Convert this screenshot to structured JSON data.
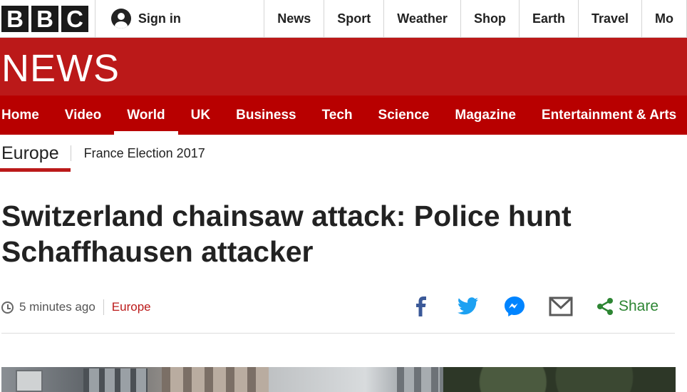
{
  "topbar": {
    "logo_letters": [
      "B",
      "B",
      "C"
    ],
    "signin_label": "Sign in",
    "nav": [
      "News",
      "Sport",
      "Weather",
      "Shop",
      "Earth",
      "Travel",
      "Mo"
    ]
  },
  "news": {
    "wordmark": "NEWS",
    "sections": [
      "Home",
      "Video",
      "World",
      "UK",
      "Business",
      "Tech",
      "Science",
      "Magazine",
      "Entertainment & Arts"
    ],
    "active_section": "World"
  },
  "subnav": {
    "current": "Europe",
    "link": "France Election 2017"
  },
  "article": {
    "headline": "Switzerland chainsaw attack: Police hunt Schaffhausen attacker",
    "timestamp": "5 minutes ago",
    "section": "Europe",
    "share_label": "Share"
  },
  "colors": {
    "brand_red": "#bb1919",
    "share_green": "#2d8533",
    "facebook_blue": "#3b5998",
    "twitter_blue": "#1da1f2",
    "messenger_blue": "#0084ff"
  },
  "icons": [
    "user-icon",
    "clock-icon",
    "facebook-icon",
    "twitter-icon",
    "messenger-icon",
    "email-icon",
    "share-icon"
  ]
}
